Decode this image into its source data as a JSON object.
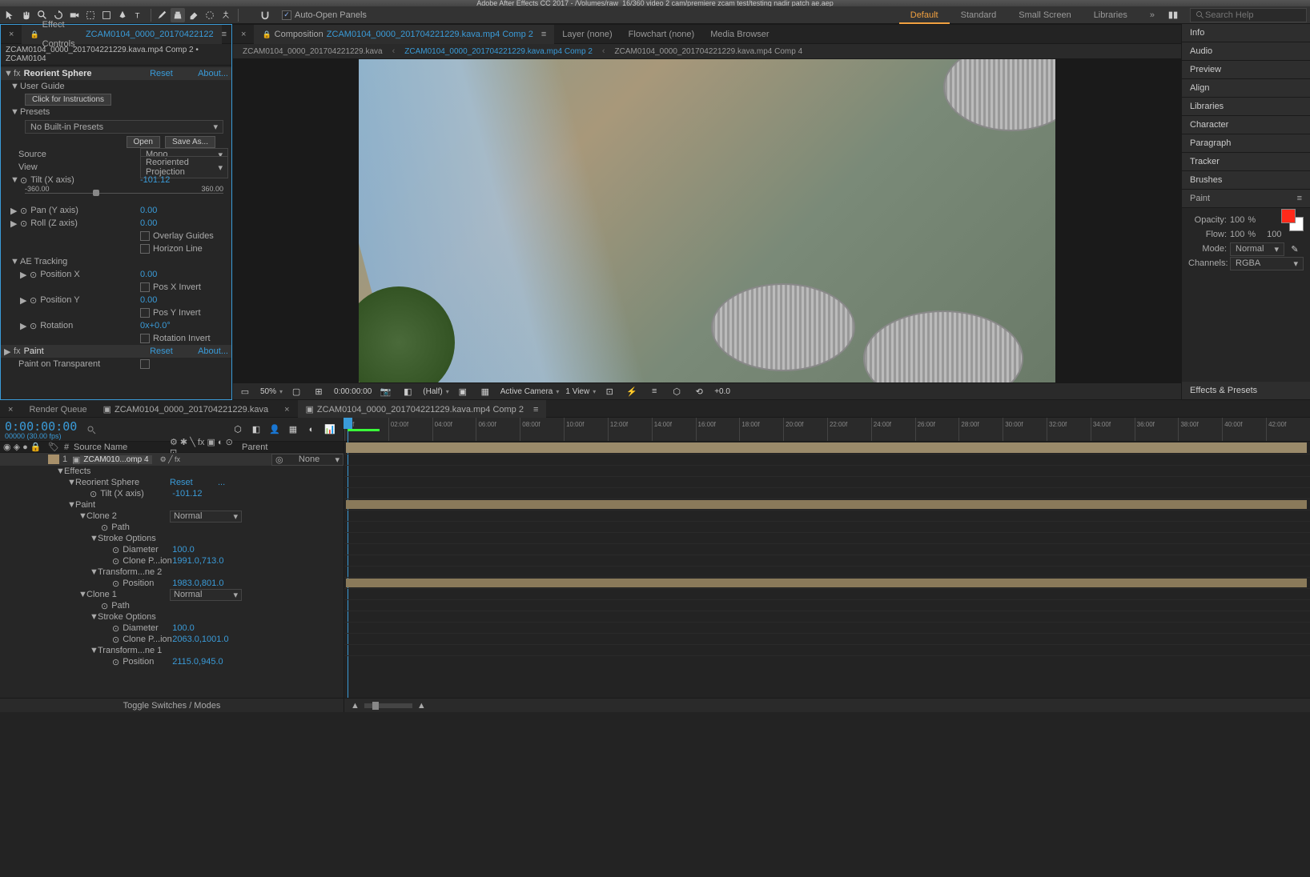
{
  "titlebar": "Adobe After Effects CC 2017 - /Volumes/raw_16/360 video 2 cam/premiere zcam test/testing nadir patch ae.aep",
  "toolbar": {
    "auto_open_label": "Auto-Open Panels",
    "search_placeholder": "Search Help"
  },
  "workspaces": {
    "default": "Default",
    "standard": "Standard",
    "small_screen": "Small Screen",
    "libraries": "Libraries"
  },
  "effect_controls": {
    "tab_prefix": "Effect Controls ",
    "tab_file": "ZCAM0104_0000_20170422122",
    "breadcrumb": "ZCAM0104_0000_201704221229.kava.mp4 Comp 2 • ZCAM0104",
    "fx1": {
      "name": "Reorient Sphere",
      "reset": "Reset",
      "about": "About..."
    },
    "user_guide": "User Guide",
    "click_instructions": "Click for Instructions",
    "presets_label": "Presets",
    "presets_value": "No Built-in Presets",
    "open_btn": "Open",
    "saveas_btn": "Save As...",
    "source_label": "Source",
    "source_value": "Mono",
    "view_label": "View",
    "view_value": "Reoriented Projection",
    "tilt_label": "Tilt (X axis)",
    "tilt_value": "-101.12",
    "tilt_min": "-360.00",
    "tilt_max": "360.00",
    "pan_label": "Pan (Y axis)",
    "pan_value": "0.00",
    "roll_label": "Roll (Z axis)",
    "roll_value": "0.00",
    "overlay_guides": "Overlay Guides",
    "horizon_line": "Horizon Line",
    "ae_tracking": "AE Tracking",
    "posx_label": "Position X",
    "posx_value": "0.00",
    "posx_invert": "Pos X Invert",
    "posy_label": "Position Y",
    "posy_value": "0.00",
    "posy_invert": "Pos Y Invert",
    "rotation_label": "Rotation",
    "rotation_value": "0x+0.0°",
    "rotation_invert": "Rotation Invert",
    "fx2": {
      "name": "Paint",
      "reset": "Reset",
      "about": "About..."
    },
    "paint_transparent": "Paint on Transparent"
  },
  "composition": {
    "tab_prefix": "Composition ",
    "tab_file": "ZCAM0104_0000_201704221229.kava.mp4 Comp 2",
    "layer_tab": "Layer (none)",
    "flowchart_tab": "Flowchart (none)",
    "media_browser_tab": "Media Browser",
    "subtabs": {
      "a": "ZCAM0104_0000_201704221229.kava",
      "b": "ZCAM0104_0000_201704221229.kava.mp4 Comp 2",
      "c": "ZCAM0104_0000_201704221229.kava.mp4 Comp 4"
    },
    "footer": {
      "zoom": "50%",
      "timecode": "0:00:00:00",
      "res": "(Half)",
      "camera": "Active Camera",
      "views": "1 View",
      "exposure": "+0.0"
    }
  },
  "right_panels": {
    "info": "Info",
    "audio": "Audio",
    "preview": "Preview",
    "align": "Align",
    "libraries": "Libraries",
    "character": "Character",
    "paragraph": "Paragraph",
    "tracker": "Tracker",
    "brushes": "Brushes",
    "paint": "Paint",
    "effects_presets": "Effects & Presets"
  },
  "paint_panel": {
    "opacity_label": "Opacity:",
    "opacity_val": "100",
    "opacity_unit": "%",
    "flow_label": "Flow:",
    "flow_val": "100",
    "flow_unit": "%",
    "spacing_val": "100",
    "mode_label": "Mode:",
    "mode_val": "Normal",
    "channels_label": "Channels:",
    "channels_val": "RGBA",
    "fg_color": "#ff2a1a",
    "bg_color": "#ffffff"
  },
  "timeline": {
    "tabs": {
      "render_queue": "Render Queue",
      "tab1": "ZCAM0104_0000_201704221229.kava",
      "tab2": "ZCAM0104_0000_201704221229.kava.mp4 Comp 2"
    },
    "timecode": "0:00:00:00",
    "fps": "00000 (30.00 fps)",
    "cols": {
      "num": "#",
      "source": "Source Name",
      "parent": "Parent"
    },
    "layer1": {
      "num": "1",
      "name": "ZCAM010...omp 4",
      "parent": "None"
    },
    "effects_label": "Effects",
    "reorient": {
      "name": "Reorient Sphere",
      "reset": "Reset",
      "dots": "..."
    },
    "tilt": {
      "label": "Tilt (X axis)",
      "value": "-101.12"
    },
    "paint_label": "Paint",
    "clone2": {
      "name": "Clone 2",
      "mode": "Normal",
      "path": "Path",
      "stroke_options": "Stroke Options",
      "diameter_label": "Diameter",
      "diameter_val": "100.0",
      "clonepos_label": "Clone P...ion",
      "clonepos_val": "1991.0,713.0",
      "transform_label": "Transform...ne 2",
      "position_label": "Position",
      "position_val": "1983.0,801.0"
    },
    "clone1": {
      "name": "Clone 1",
      "mode": "Normal",
      "path": "Path",
      "stroke_options": "Stroke Options",
      "diameter_label": "Diameter",
      "diameter_val": "100.0",
      "clonepos_label": "Clone P...ion",
      "clonepos_val": "2063.0,1001.0",
      "transform_label": "Transform...ne 1",
      "position_label": "Position",
      "position_val": "2115.0,945.0"
    },
    "footer": "Toggle Switches / Modes",
    "ruler_ticks": [
      ")0f",
      "02:00f",
      "04:00f",
      "06:00f",
      "08:00f",
      "10:00f",
      "12:00f",
      "14:00f",
      "16:00f",
      "18:00f",
      "20:00f",
      "22:00f",
      "24:00f",
      "26:00f",
      "28:00f",
      "30:00f",
      "32:00f",
      "34:00f",
      "36:00f",
      "38:00f",
      "40:00f",
      "42:00f"
    ]
  }
}
